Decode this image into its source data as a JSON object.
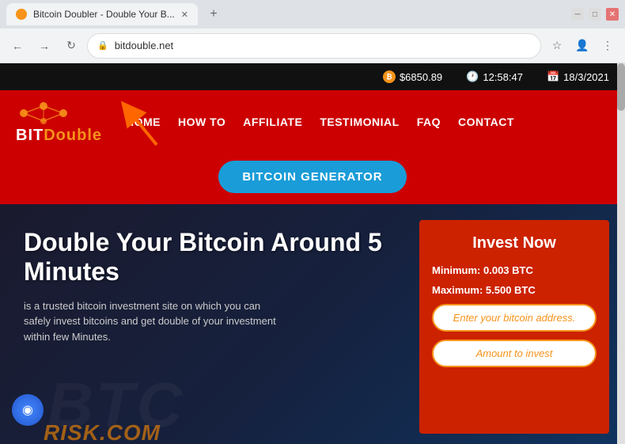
{
  "browser": {
    "tab_title": "Bitcoin Doubler - Double Your B...",
    "url": "bitdouble.net",
    "new_tab_symbol": "+",
    "back_symbol": "←",
    "forward_symbol": "→",
    "refresh_symbol": "↻",
    "bookmark_symbol": "☆",
    "account_symbol": "👤",
    "menu_symbol": "⋮"
  },
  "topbar": {
    "price": "$6850.89",
    "time": "12:58:47",
    "date": "18/3/2021"
  },
  "header": {
    "logo_bit": "BIT",
    "logo_double": "Double",
    "nav_items": [
      "HOME",
      "HOW TO",
      "AFFILIATE",
      "TESTIMONIAL",
      "FAQ",
      "CONTACT"
    ]
  },
  "hero_button": {
    "label": "BITCOIN GENERATOR"
  },
  "hero": {
    "title": "Double Your Bitcoin Around 5 Minutes",
    "subtitle": "is a trusted bitcoin investment site on which you can safely invest bitcoins and get double of your investment within few Minutes."
  },
  "invest_panel": {
    "title": "Invest Now",
    "minimum": "Minimum: 0.003 BTC",
    "maximum": "Maximum: 5.500 BTC",
    "address_placeholder": "Enter your bitcoin address.",
    "amount_placeholder": "Amount to invest"
  },
  "watermark": {
    "text": "RISK.COM"
  }
}
